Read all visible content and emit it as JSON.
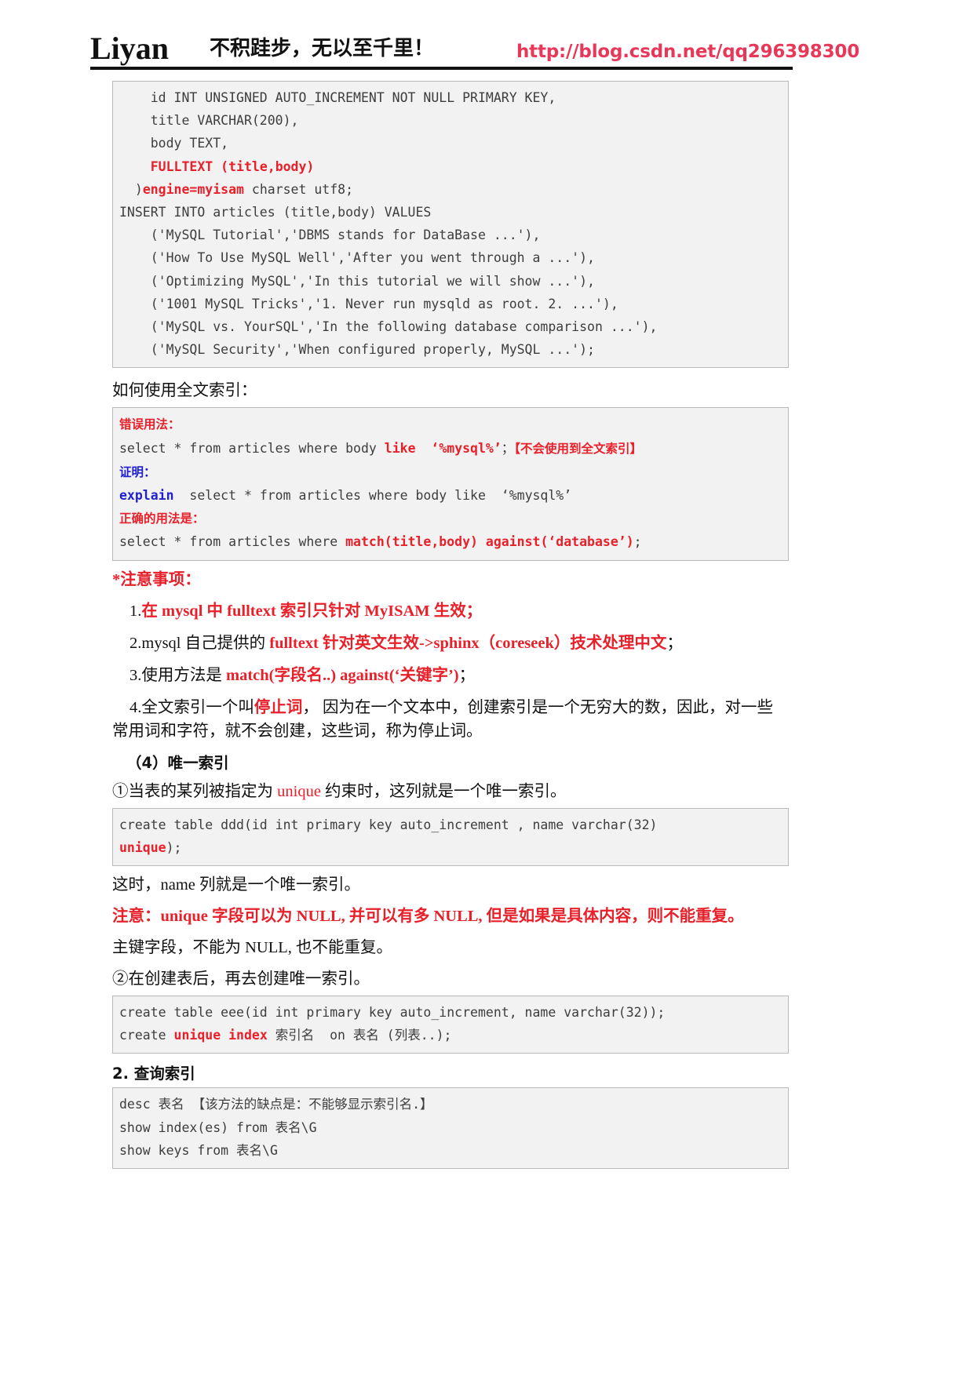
{
  "banner": {
    "logo": "Liyan",
    "slogan": "不积跬步，无以至千里！",
    "url": "http://blog.csdn.net/qq296398300"
  },
  "code_block_1": {
    "name": "create-table-articles-code",
    "lines": [
      {
        "segments": [
          {
            "text": "    id INT UNSIGNED AUTO_INCREMENT NOT NULL PRIMARY KEY,",
            "style": "plain"
          }
        ]
      },
      {
        "segments": [
          {
            "text": "    title VARCHAR(200),",
            "style": "plain"
          }
        ]
      },
      {
        "segments": [
          {
            "text": "    body TEXT,",
            "style": "plain"
          }
        ]
      },
      {
        "segments": [
          {
            "text": "    ",
            "style": "plain"
          },
          {
            "text": "FULLTEXT (title,body)",
            "style": "red-bold"
          }
        ]
      },
      {
        "segments": [
          {
            "text": "  )",
            "style": "plain"
          },
          {
            "text": "engine=myisam",
            "style": "red-bold"
          },
          {
            "text": " charset utf8;",
            "style": "plain"
          }
        ]
      },
      {
        "segments": [
          {
            "text": "INSERT INTO articles (title,body) VALUES",
            "style": "plain"
          }
        ]
      },
      {
        "segments": [
          {
            "text": "    ('MySQL Tutorial','DBMS stands for DataBase ...'),",
            "style": "plain"
          }
        ]
      },
      {
        "segments": [
          {
            "text": "    ('How To Use MySQL Well','After you went through a ...'),",
            "style": "plain"
          }
        ]
      },
      {
        "segments": [
          {
            "text": "    ('Optimizing MySQL','In this tutorial we will show ...'),",
            "style": "plain"
          }
        ]
      },
      {
        "segments": [
          {
            "text": "    ('1001 MySQL Tricks','1. Never run mysqld as root. 2. ...'),",
            "style": "plain"
          }
        ]
      },
      {
        "segments": [
          {
            "text": "    ('MySQL vs. YourSQL','In the following database comparison ...'),",
            "style": "plain"
          }
        ]
      },
      {
        "segments": [
          {
            "text": "    ('MySQL Security','When configured properly, MySQL ...');",
            "style": "plain"
          }
        ]
      }
    ]
  },
  "para_how_to_use": "如何使用全文索引：",
  "code_block_2": {
    "name": "fulltext-usage-code",
    "lines": [
      {
        "segments": [
          {
            "text": "错误用法：",
            "style": "cjk-red-bold"
          }
        ]
      },
      {
        "segments": [
          {
            "text": "select * from articles where body ",
            "style": "plain"
          },
          {
            "text": "like",
            "style": "red-bold"
          },
          {
            "text": "  ",
            "style": "plain"
          },
          {
            "text": "‘%mysql%’",
            "style": "red-bold"
          },
          {
            "text": "；",
            "style": "plain"
          },
          {
            "text": "【不会使用到全文索引】",
            "style": "cjk-red-bold"
          }
        ]
      },
      {
        "segments": [
          {
            "text": "证明：",
            "style": "cjk-blue-bold"
          }
        ]
      },
      {
        "segments": [
          {
            "text": "explain",
            "style": "blue-bold"
          },
          {
            "text": "  select * from articles where body like  ‘%mysql%’",
            "style": "plain"
          }
        ]
      },
      {
        "segments": [
          {
            "text": "正确的用法是：",
            "style": "cjk-red-bold"
          }
        ]
      },
      {
        "segments": [
          {
            "text": "select * from articles where ",
            "style": "plain"
          },
          {
            "text": "match(title,body) against(‘database’)",
            "style": "red-bold"
          },
          {
            "text": ";",
            "style": "plain"
          }
        ]
      }
    ]
  },
  "notice": {
    "heading": "*注意事项：",
    "items": [
      {
        "number": "1.",
        "segments": [
          {
            "text": "在 mysql 中 fulltext 索引只针对 MyISAM 生效；",
            "style": "red-bold"
          }
        ]
      },
      {
        "number": "2.",
        "segments": [
          {
            "text": "mysql 自己提供的 ",
            "style": "plain"
          },
          {
            "text": "fulltext 针对英文生效->sphinx（coreseek）技术处理中文",
            "style": "red-bold"
          },
          {
            "text": "；",
            "style": "plain"
          }
        ]
      },
      {
        "number": "3.",
        "segments": [
          {
            "text": "使用方法是 ",
            "style": "plain"
          },
          {
            "text": "match(字段名..) against(‘关键字’)",
            "style": "red-bold"
          },
          {
            "text": "；",
            "style": "plain"
          }
        ]
      },
      {
        "number": "4.",
        "segments": [
          {
            "text": "全文索引一个叫",
            "style": "plain"
          },
          {
            "text": "停止词",
            "style": "red-bold"
          },
          {
            "text": "，  因为在一个文本中，创建索引是一个无穷大的数，因此，对一些常用词和字符，就不会创建，这些词，称为停止词。",
            "style": "plain"
          }
        ]
      }
    ]
  },
  "section_unique": {
    "heading": "（4）唯一索引",
    "point1": {
      "segments": [
        {
          "text": "①当表的某列被指定为 ",
          "style": "plain"
        },
        {
          "text": "unique",
          "style": "red"
        },
        {
          "text": " 约束时，这列就是一个唯一索引。",
          "style": "plain"
        }
      ]
    },
    "code_block_3": {
      "name": "create-table-ddd-code",
      "lines": [
        {
          "segments": [
            {
              "text": "create table ddd(id int primary key auto_increment , name varchar(32)",
              "style": "plain"
            }
          ]
        },
        {
          "segments": [
            {
              "text": "unique",
              "style": "red-bold"
            },
            {
              "text": ");",
              "style": "plain"
            }
          ]
        }
      ]
    },
    "after_code": "这时，name 列就是一个唯一索引。",
    "warning": "注意：unique 字段可以为 NULL, 并可以有多 NULL, 但是如果是具体内容，则不能重复。",
    "primary_note": "主键字段，不能为 NULL, 也不能重复。",
    "point2": "②在创建表后，再去创建唯一索引。",
    "code_block_4": {
      "name": "create-unique-index-code",
      "lines": [
        {
          "segments": [
            {
              "text": "create table eee(id int primary key auto_increment, name varchar(32));",
              "style": "plain"
            }
          ]
        },
        {
          "segments": [
            {
              "text": "create ",
              "style": "plain"
            },
            {
              "text": "unique index",
              "style": "red-bold"
            },
            {
              "text": " 索引名  on 表名 (列表..);",
              "style": "plain"
            }
          ]
        }
      ]
    }
  },
  "section_query": {
    "heading": "2. 查询索引",
    "code_block_5": {
      "name": "query-index-code",
      "lines": [
        {
          "segments": [
            {
              "text": "desc 表名 【该方法的缺点是：不能够显示索引名.】",
              "style": "plain"
            }
          ]
        },
        {
          "segments": [
            {
              "text": "show index(es) from 表名\\G",
              "style": "plain"
            }
          ]
        },
        {
          "segments": [
            {
              "text": "show keys from 表名\\G",
              "style": "plain"
            }
          ]
        }
      ]
    }
  },
  "colors": {
    "accent_red": "#e8202a",
    "accent_blue": "#2020d0",
    "url_pink": "#e8385a",
    "code_bg": "#f2f2f2",
    "code_border": "#b9b9b9",
    "code_text": "#3d3d3d"
  }
}
